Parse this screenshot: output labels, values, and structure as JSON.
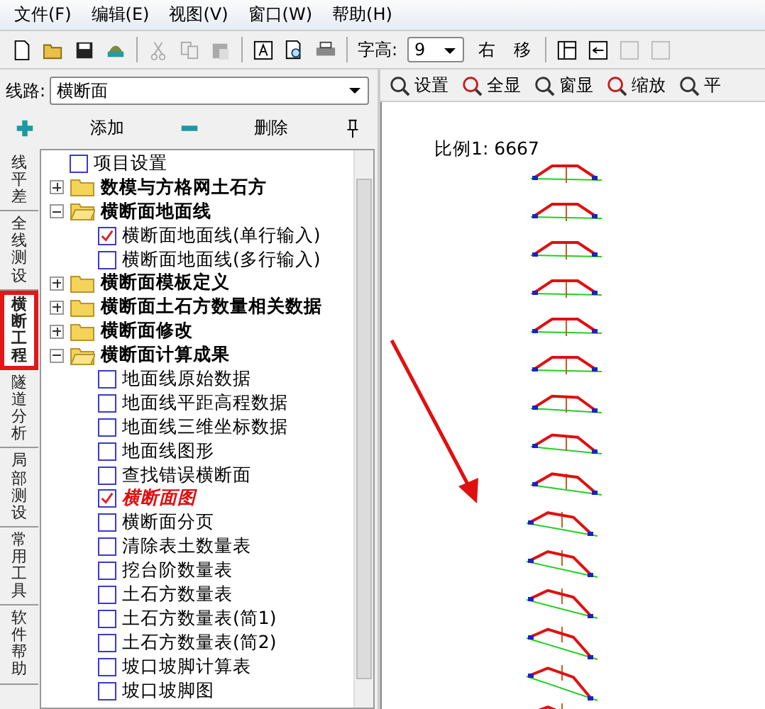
{
  "menu": [
    "文件(F)",
    "编辑(E)",
    "视图(V)",
    "窗口(W)",
    "帮助(H)"
  ],
  "toolbar": {
    "font_height_label": "字高:",
    "font_height_value": "9",
    "buttons": [
      "右",
      "移"
    ]
  },
  "route": {
    "label": "线路:",
    "value": "横断面"
  },
  "actions": {
    "add": "添加",
    "delete": "删除"
  },
  "side_tabs": [
    {
      "label": "线平差",
      "selected": false
    },
    {
      "label": "全线测设",
      "selected": false
    },
    {
      "label": "横断工程",
      "selected": true
    },
    {
      "label": "隧道分析",
      "selected": false
    },
    {
      "label": "局部测设",
      "selected": false
    },
    {
      "label": "常用工具",
      "selected": false
    },
    {
      "label": "软件帮助",
      "selected": false
    }
  ],
  "tree": [
    {
      "kind": "item",
      "label": "项目设置",
      "checked": false,
      "active": false
    },
    {
      "kind": "folder",
      "label": "数模与方格网土石方",
      "expanded": false
    },
    {
      "kind": "folder",
      "label": "横断面地面线",
      "expanded": true,
      "children": [
        {
          "kind": "item",
          "label": "横断面地面线(单行输入)",
          "checked": true,
          "active": false
        },
        {
          "kind": "item",
          "label": "横断面地面线(多行输入)",
          "checked": false,
          "active": false
        }
      ]
    },
    {
      "kind": "folder",
      "label": "横断面模板定义",
      "expanded": false
    },
    {
      "kind": "folder",
      "label": "横断面土石方数量相关数据",
      "expanded": false
    },
    {
      "kind": "folder",
      "label": "横断面修改",
      "expanded": false
    },
    {
      "kind": "folder",
      "label": "横断面计算成果",
      "expanded": true,
      "children": [
        {
          "kind": "item",
          "label": "地面线原始数据",
          "checked": false,
          "active": false
        },
        {
          "kind": "item",
          "label": "地面线平距高程数据",
          "checked": false,
          "active": false
        },
        {
          "kind": "item",
          "label": "地面线三维坐标数据",
          "checked": false,
          "active": false
        },
        {
          "kind": "item",
          "label": "地面线图形",
          "checked": false,
          "active": false
        },
        {
          "kind": "item",
          "label": "查找错误横断面",
          "checked": false,
          "active": false
        },
        {
          "kind": "item",
          "label": "横断面图",
          "checked": true,
          "active": true
        },
        {
          "kind": "item",
          "label": "横断面分页",
          "checked": false,
          "active": false
        },
        {
          "kind": "item",
          "label": "清除表土数量表",
          "checked": false,
          "active": false
        },
        {
          "kind": "item",
          "label": "挖台阶数量表",
          "checked": false,
          "active": false
        },
        {
          "kind": "item",
          "label": "土石方数量表",
          "checked": false,
          "active": false
        },
        {
          "kind": "item",
          "label": "土石方数量表(简1)",
          "checked": false,
          "active": false
        },
        {
          "kind": "item",
          "label": "土石方数量表(简2)",
          "checked": false,
          "active": false
        },
        {
          "kind": "item",
          "label": "坡口坡脚计算表",
          "checked": false,
          "active": false
        },
        {
          "kind": "item",
          "label": "坡口坡脚图",
          "checked": false,
          "active": false
        }
      ]
    }
  ],
  "view_toolbar": [
    "设置",
    "全显",
    "窗显",
    "缩放",
    "平"
  ],
  "scale": "比例1: 6667"
}
